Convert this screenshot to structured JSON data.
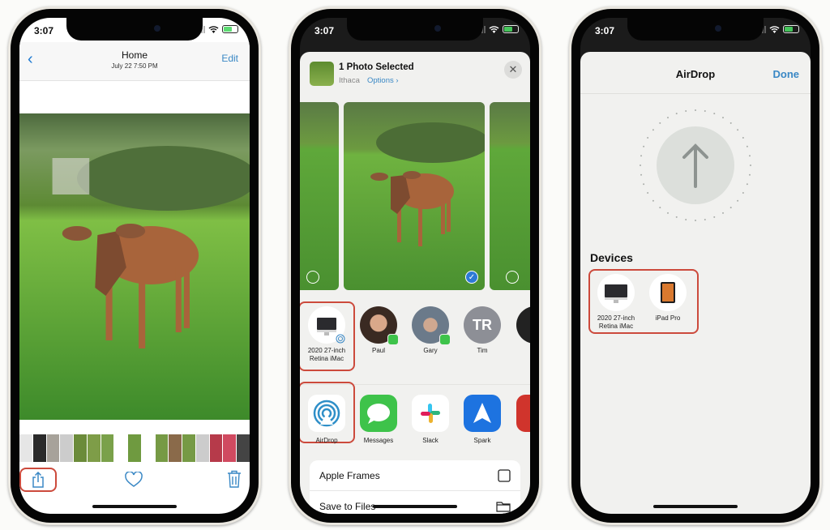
{
  "status": {
    "time": "3:07"
  },
  "photos": {
    "nav": {
      "back_label": "‹",
      "title": "Home",
      "subtitle": "July 22  7:50 PM",
      "edit_label": "Edit"
    },
    "toolbar": {
      "share_icon": "share-icon",
      "heart_icon": "heart-icon",
      "trash_icon": "trash-icon"
    }
  },
  "share_sheet": {
    "header": {
      "title": "1 Photo Selected",
      "location": "Ithaca",
      "options_label": "Options ›",
      "close_label": "✕"
    },
    "people": [
      {
        "name": "2020 27-inch Retina iMac",
        "type": "airdrop-device"
      },
      {
        "name": "Paul",
        "type": "messages"
      },
      {
        "name": "Gary",
        "type": "messages"
      },
      {
        "name": "Tim",
        "initials": "TR",
        "type": "messages"
      }
    ],
    "apps": [
      {
        "name": "AirDrop"
      },
      {
        "name": "Messages"
      },
      {
        "name": "Slack"
      },
      {
        "name": "Spark"
      }
    ],
    "actions": [
      {
        "label": "Apple Frames",
        "icon": "square-icon"
      },
      {
        "label": "Save to Files",
        "icon": "folder-icon"
      }
    ]
  },
  "airdrop": {
    "title": "AirDrop",
    "done_label": "Done",
    "devices_heading": "Devices",
    "devices": [
      {
        "name": "2020 27-inch Retina iMac"
      },
      {
        "name": "iPad Pro"
      }
    ]
  },
  "colors": {
    "accent": "#3a88c5",
    "highlight": "#cc4a3c",
    "messages_green": "#3ec34a",
    "spark_blue": "#1d73e0"
  }
}
